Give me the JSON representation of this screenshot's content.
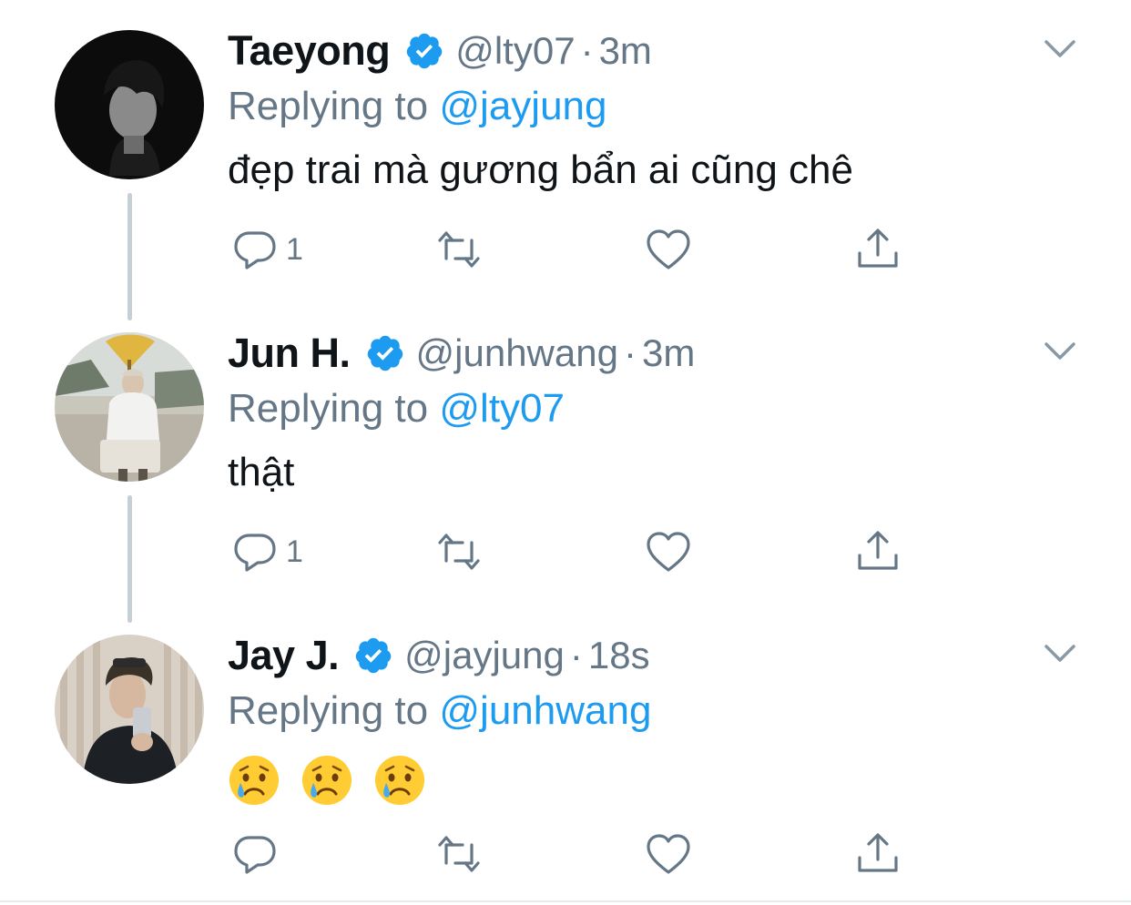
{
  "tweets": [
    {
      "name": "Taeyong",
      "handle": "@lty07",
      "sep": "·",
      "time": "3m",
      "replying_prefix": "Replying to",
      "replying_to": "@jayjung",
      "text": "đẹp trai mà gương bẩn ai cũng chê",
      "reply_count": "1"
    },
    {
      "name": "Jun H.",
      "handle": "@junhwang",
      "sep": "·",
      "time": "3m",
      "replying_prefix": "Replying to",
      "replying_to": "@lty07",
      "text": "thật",
      "reply_count": "1"
    },
    {
      "name": "Jay J.",
      "handle": "@jayjung",
      "sep": "·",
      "time": "18s",
      "replying_prefix": "Replying to",
      "replying_to": "@junhwang",
      "emojis": [
        "crying-face",
        "crying-face",
        "crying-face"
      ],
      "reply_count": ""
    }
  ],
  "icons": {
    "verified": "verified-badge-icon",
    "reply": "reply-bubble-icon",
    "retweet": "retweet-icon",
    "like": "heart-icon",
    "share": "share-icon",
    "more": "chevron-down-icon"
  },
  "colors": {
    "accent": "#1d9bf0",
    "secondary_text": "#657786",
    "thread_line": "#c4cfd6"
  }
}
